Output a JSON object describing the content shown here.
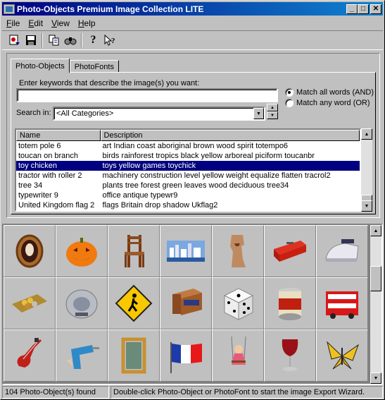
{
  "window": {
    "title": "Photo-Objects Premium Image Collection LITE"
  },
  "menu": [
    "File",
    "Edit",
    "View",
    "Help"
  ],
  "toolbar": {
    "icons": [
      "export-icon",
      "save-icon",
      "copy-icon",
      "find-icon",
      "help-icon",
      "context-help-icon"
    ]
  },
  "tabs": [
    "Photo-Objects",
    "PhotoFonts"
  ],
  "search": {
    "keywords_label": "Enter keywords that describe the image(s) you want:",
    "keywords_value": "",
    "search_in_label": "Search in:",
    "search_in_value": "<All Categories>",
    "match_all": "Match all words (AND)",
    "match_any": "Match any word (OR)",
    "match_mode": "all"
  },
  "list": {
    "columns": [
      "Name",
      "Description"
    ],
    "rows": [
      {
        "name": "totem pole 6",
        "desc": "art Indian coast aboriginal brown wood spirit totempo6",
        "selected": false
      },
      {
        "name": "toucan on branch",
        "desc": "birds rainforest tropics black yellow arboreal piciform toucanbr",
        "selected": false
      },
      {
        "name": "toy chicken",
        "desc": "toys yellow games toychick",
        "selected": true
      },
      {
        "name": "tractor with roller 2",
        "desc": "machinery construction level yellow weight equalize flatten tracrol2",
        "selected": false
      },
      {
        "name": "tree 34",
        "desc": "plants tree forest green leaves wood deciduous tree34",
        "selected": false
      },
      {
        "name": "typewriter 9",
        "desc": "office antique typewr9",
        "selected": false
      },
      {
        "name": "United Kingdom flag 2",
        "desc": "flags Britain drop shadow Ukflag2",
        "selected": false
      }
    ]
  },
  "gallery": {
    "items": [
      "cameo-icon",
      "jack-o-lantern-icon",
      "wooden-chair-icon",
      "city-skyline-icon",
      "moai-statue-icon",
      "toolbox-icon",
      "steam-iron-icon",
      "coin-tray-icon",
      "cd-player-icon",
      "pedestrian-sign-icon",
      "nightstand-icon",
      "dice-icon",
      "paint-can-icon",
      "double-decker-bus-icon",
      "electric-guitar-icon",
      "power-drill-icon",
      "picture-frame-icon",
      "french-flag-icon",
      "girl-on-swing-icon",
      "wine-glass-icon",
      "butterfly-icon"
    ]
  },
  "status": {
    "count": "104 Photo-Object(s) found",
    "hint": "Double-click Photo-Object or PhotoFont to start the image Export Wizard."
  }
}
